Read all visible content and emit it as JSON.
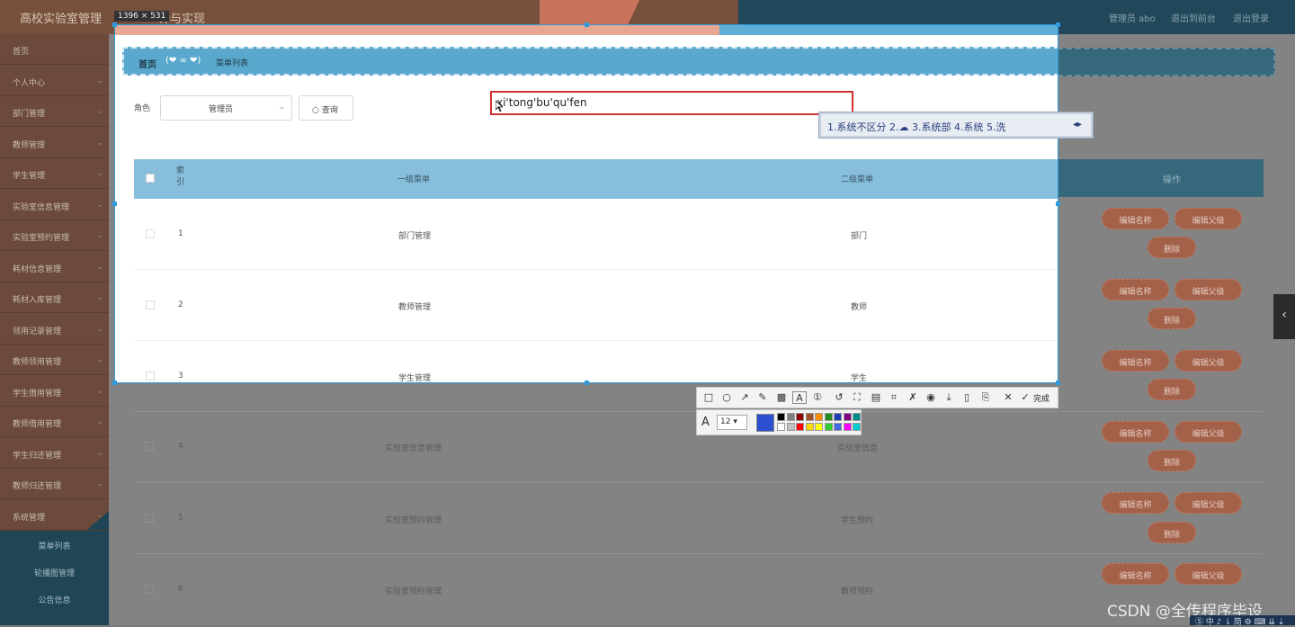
{
  "app": {
    "title": "高校实验室管理",
    "title_tail": "计与实现",
    "admin": "管理员 abo",
    "back_front": "退出到前台",
    "logout": "退出登录"
  },
  "sidebar": {
    "items": [
      "首页",
      "个人中心",
      "部门管理",
      "教师管理",
      "学生管理",
      "实验室信息管理",
      "实验室预约管理",
      "耗材信息管理",
      "耗材入库管理",
      "领用记录管理",
      "教师领用管理",
      "学生借用管理",
      "教师借用管理",
      "学生归还管理",
      "教师归还管理",
      "系统管理"
    ],
    "subitems": [
      "菜单列表",
      "轮播图管理",
      "公告信息"
    ]
  },
  "capture": {
    "size_label": "1396 × 531"
  },
  "breadcrumb": {
    "home": "首页",
    "decor": "(❤ ∞ ❤)",
    "current": "菜单列表"
  },
  "search": {
    "role_label": "角色",
    "role_value": "管理员",
    "query_button": "查询"
  },
  "ime": {
    "composition": "xi'tong'bu'qu'fen",
    "candidates": "1.系统不区分  2.☁  3.系统部  4.系统  5.洗",
    "arrows": "◂▸"
  },
  "table": {
    "headers": {
      "index": "索\n引",
      "level1": "一级菜单",
      "level2": "二级菜单",
      "ops": "操作"
    },
    "rows": [
      {
        "index": "1",
        "level1": "部门管理",
        "level2": "部门"
      },
      {
        "index": "2",
        "level1": "教师管理",
        "level2": "教师"
      },
      {
        "index": "3",
        "level1": "学生管理",
        "level2": "学生"
      },
      {
        "index": "4",
        "level1": "实验室信息管理",
        "level2": "实验室信息"
      },
      {
        "index": "5",
        "level1": "实验室预约管理",
        "level2": "学生预约"
      },
      {
        "index": "6",
        "level1": "实验室预约管理",
        "level2": "教师预约"
      }
    ],
    "actions": {
      "edit_name": "编辑名称",
      "edit_parent": "编辑父级",
      "delete": "删除"
    }
  },
  "screenshot_toolbar": {
    "tools": [
      "rect-tool",
      "ellipse-tool",
      "arrow-tool",
      "pen-tool",
      "mosaic-tool",
      "text-tool",
      "number-tool",
      "undo-tool",
      "crop-tool",
      "translate-tool",
      "ocr-tool",
      "pin-tool",
      "record-tool",
      "save-tool",
      "long-shot-tool",
      "bookmark-tool",
      "cancel-tool"
    ],
    "done": "完成",
    "font_size": "12 ▾",
    "current_color": "#2c4fd0",
    "swatches_top": [
      "#000000",
      "#808080",
      "#8b0000",
      "#a0522d",
      "#ff8c00",
      "#228b22",
      "#1e3cb4",
      "#800080",
      "#008b8b"
    ],
    "swatches_bottom": [
      "#ffffff",
      "#c0c0c0",
      "#ff0000",
      "#ffd700",
      "#ffff00",
      "#32cd32",
      "#4169e1",
      "#ff00ff",
      "#00ced1"
    ]
  },
  "watermark": "CSDN @全传程序毕设",
  "taskbar": "Ⓢ 中 ♪ ⇂ 简 ⚙ ⌨ ⇊ ⇣"
}
